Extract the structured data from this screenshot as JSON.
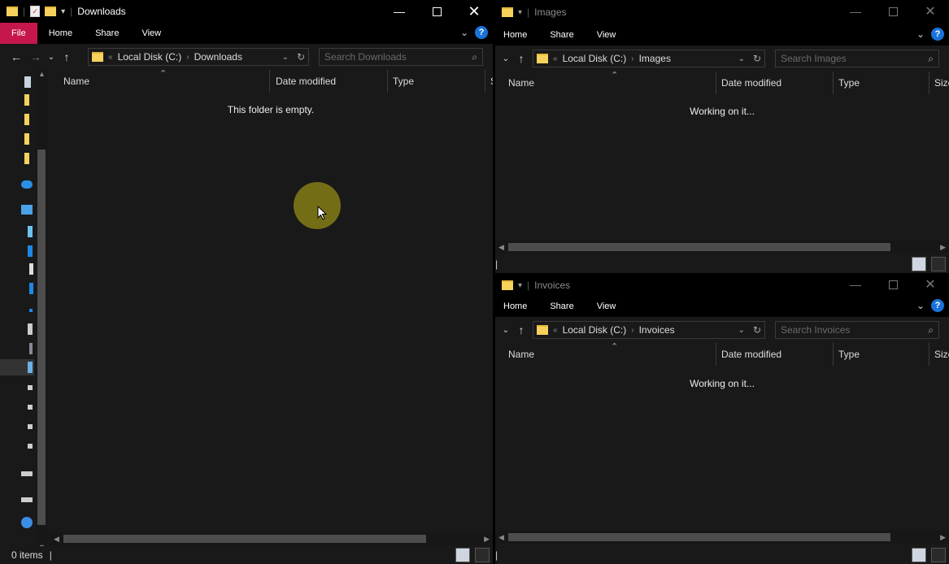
{
  "windows": {
    "downloads": {
      "title": "Downloads",
      "ribbon": {
        "file": "File",
        "home": "Home",
        "share": "Share",
        "view": "View",
        "help": "?"
      },
      "address": {
        "root": "Local Disk (C:)",
        "current": "Downloads",
        "overflow": "«"
      },
      "search_placeholder": "Search Downloads",
      "columns": {
        "name": "Name",
        "date": "Date modified",
        "type": "Type",
        "size": "S"
      },
      "message": "This folder is empty.",
      "status": "0 items"
    },
    "images": {
      "title": "Images",
      "ribbon": {
        "home": "Home",
        "share": "Share",
        "view": "View",
        "help": "?"
      },
      "address": {
        "root": "Local Disk (C:)",
        "current": "Images",
        "overflow": "«"
      },
      "search_placeholder": "Search Images",
      "columns": {
        "name": "Name",
        "date": "Date modified",
        "type": "Type",
        "size": "Size"
      },
      "message": "Working on it..."
    },
    "invoices": {
      "title": "Invoices",
      "ribbon": {
        "home": "Home",
        "share": "Share",
        "view": "View",
        "help": "?"
      },
      "address": {
        "root": "Local Disk (C:)",
        "current": "Invoices",
        "overflow": "«"
      },
      "search_placeholder": "Search Invoices",
      "columns": {
        "name": "Name",
        "date": "Date modified",
        "type": "Type",
        "size": "Size"
      },
      "message": "Working on it..."
    }
  },
  "colors": {
    "file_tab": "#c5174b",
    "window_bg": "#191919",
    "titlebar_bg": "#000000",
    "cursor_highlight": "#b4aa14"
  },
  "icons": {
    "minimize": "minimize-icon",
    "maximize": "maximize-icon",
    "close": "close-icon",
    "back": "back-arrow-icon",
    "forward": "forward-arrow-icon",
    "up": "up-arrow-icon",
    "refresh": "refresh-icon",
    "search": "search-icon"
  }
}
